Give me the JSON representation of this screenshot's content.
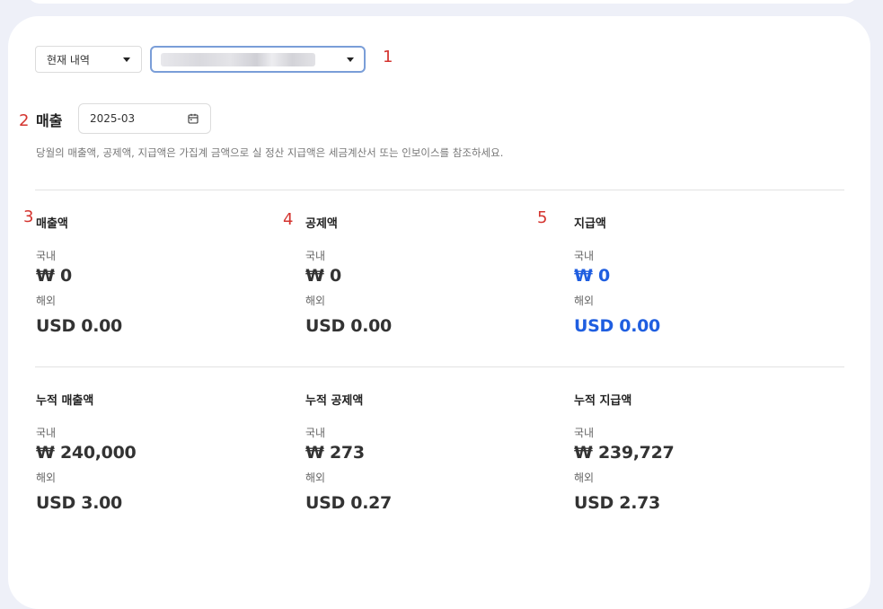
{
  "filters": {
    "period_select": "현재 내역",
    "account_select_value": ""
  },
  "annotations": [
    "1",
    "2",
    "3",
    "4",
    "5"
  ],
  "sales": {
    "title": "매출",
    "date": "2025-03",
    "notice": "당월의 매출액, 공제액, 지급액은 가집계 금액으로 실 정산 지급액은 세금계산서 또는 인보이스를 참조하세요."
  },
  "monthly": [
    {
      "title": "매출액",
      "domestic_label": "국내",
      "domestic": "₩ 0",
      "overseas_label": "해외",
      "overseas": "USD 0.00",
      "highlight": false
    },
    {
      "title": "공제액",
      "domestic_label": "국내",
      "domestic": "₩ 0",
      "overseas_label": "해외",
      "overseas": "USD 0.00",
      "highlight": false
    },
    {
      "title": "지급액",
      "domestic_label": "국내",
      "domestic": "₩ 0",
      "overseas_label": "해외",
      "overseas": "USD 0.00",
      "highlight": true
    }
  ],
  "cumulative": [
    {
      "title": "누적 매출액",
      "domestic_label": "국내",
      "domestic": "₩ 240,000",
      "overseas_label": "해외",
      "overseas": "USD 3.00"
    },
    {
      "title": "누적 공제액",
      "domestic_label": "국내",
      "domestic": "₩ 273",
      "overseas_label": "해외",
      "overseas": "USD 0.27"
    },
    {
      "title": "누적 지급액",
      "domestic_label": "국내",
      "domestic": "₩ 239,727",
      "overseas_label": "해외",
      "overseas": "USD 2.73"
    }
  ],
  "colors": {
    "accent_blue": "#1f5ee0",
    "annotation_red": "#d4342f",
    "focus_border": "#7a9ed8"
  },
  "icons": {
    "dropdown": "caret-down-icon",
    "calendar": "calendar-icon"
  }
}
